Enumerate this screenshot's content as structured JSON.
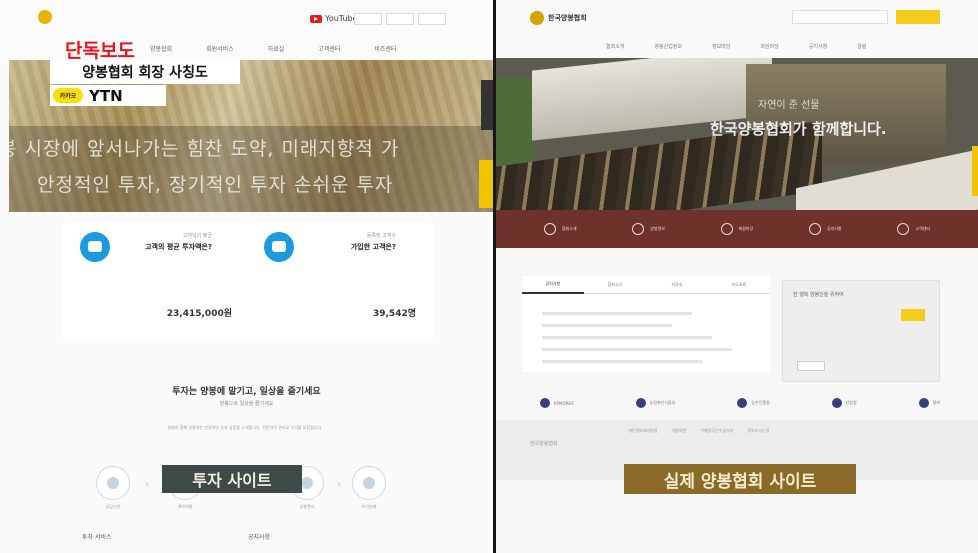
{
  "left": {
    "exclusive_label": "단독보도",
    "caption_title": "양봉협회 회장 사칭도",
    "caption_source_badge": "카카오",
    "caption_source": "YTN",
    "hero_line1": "봉 시장에 앞서나가는 힘찬 도약, 미래지향적 가",
    "hero_line2": "안정적인 투자, 장기적인 투자 손쉬운 투자",
    "nav": [
      "양봉협회",
      "회원서비스",
      "자료실",
      "고객센터",
      "비즈센터"
    ],
    "youtube_label": "YouTube",
    "stats": [
      {
        "sub": "고객님의 평균",
        "question": "고객의 평균 투자액은?",
        "value": "23,415,000원"
      },
      {
        "sub": "등록된 고객수",
        "question": "가입한 고객은?",
        "value": "39,542명"
      }
    ],
    "invest_title": "투자는       양봉에 맡기고, 일상을 즐기세요",
    "invest_sub": "양봉으로 일상을 즐기세요",
    "invest_desc": "꿀벌과 함께 성장하는 안정적인 투자 상품을 소개합니다. 전문가의 관리로 수익을 보장합니다.",
    "steps": [
      "상담신청",
      "계약체결",
      "양봉관리",
      "수익분배"
    ],
    "stamp": "투자 사이트",
    "footer_left": "투자 서비스",
    "footer_right": "공지사항"
  },
  "right": {
    "logo_text": "한국양봉협회",
    "nav": [
      "협회소개",
      "양봉산업정보",
      "정보마당",
      "회원마당",
      "공지사항",
      "알림"
    ],
    "hero_copy1": "자연이 준 선물",
    "hero_copy2": "한국양봉협회가 함께합니다.",
    "menu": [
      "협회소개",
      "양봉정보",
      "회원마당",
      "공지사항",
      "고객센터"
    ],
    "tabs": [
      "공지사항",
      "협회소식",
      "자료실",
      "보도자료"
    ],
    "login_title": "한 행복 양봉인을 위하여",
    "partners": [
      "KPMOREA",
      "농림축산식품부",
      "농촌진흥청",
      "산림청",
      "협회"
    ],
    "footer_logo": "한국양봉협회",
    "footer_links": [
      "개인정보처리방침",
      "이용약관",
      "이메일무단수집거부",
      "찾아오시는길"
    ],
    "stamp": "실제 양봉협회 사이트"
  },
  "colors": {
    "exclusive_red": "#e8121a",
    "ytn_yellow": "#f9e000",
    "menu_brown": "#6e322b",
    "stamp_left": "#3e4a47",
    "stamp_right": "#8a6a28",
    "accent_yellow": "#f4cd1c",
    "stat_blue": "#1e9be0"
  }
}
